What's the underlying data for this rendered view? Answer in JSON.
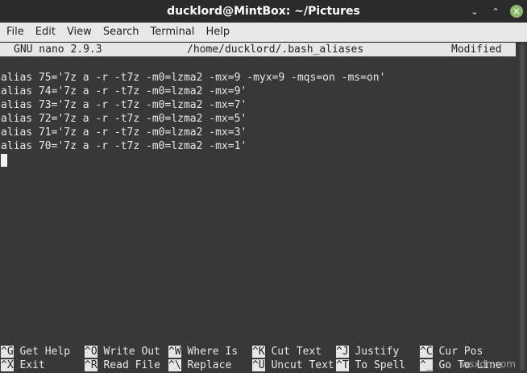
{
  "window": {
    "title": "ducklord@MintBox: ~/Pictures",
    "controls": {
      "minimize": "⌄",
      "maximize": "⌃",
      "close": "✕"
    }
  },
  "menu": [
    "File",
    "Edit",
    "View",
    "Search",
    "Terminal",
    "Help"
  ],
  "nano": {
    "version": "GNU nano 2.9.3",
    "file_path": "/home/ducklord/.bash_aliases",
    "status": "Modified",
    "lines": [
      "alias 75='7z a -r -t7z -m0=lzma2 -mx=9 -myx=9 -mqs=on -ms=on'",
      "alias 74='7z a -r -t7z -m0=lzma2 -mx=9'",
      "alias 73='7z a -r -t7z -m0=lzma2 -mx=7'",
      "alias 72='7z a -r -t7z -m0=lzma2 -mx=5'",
      "alias 71='7z a -r -t7z -m0=lzma2 -mx=3'",
      "alias 70='7z a -r -t7z -m0=lzma2 -mx=1'"
    ]
  },
  "shortcuts_row1": [
    {
      "key": "^G",
      "label": "Get Help"
    },
    {
      "key": "^O",
      "label": "Write Out"
    },
    {
      "key": "^W",
      "label": "Where Is"
    },
    {
      "key": "^K",
      "label": "Cut Text"
    },
    {
      "key": "^J",
      "label": "Justify"
    },
    {
      "key": "^C",
      "label": "Cur Pos"
    }
  ],
  "shortcuts_row2": [
    {
      "key": "^X",
      "label": "Exit"
    },
    {
      "key": "^R",
      "label": "Read File"
    },
    {
      "key": "^\\",
      "label": "Replace"
    },
    {
      "key": "^U",
      "label": "Uncut Text"
    },
    {
      "key": "^T",
      "label": "To Spell"
    },
    {
      "key": "^_",
      "label": "Go To Line"
    }
  ],
  "watermark": "wsxdn.com"
}
